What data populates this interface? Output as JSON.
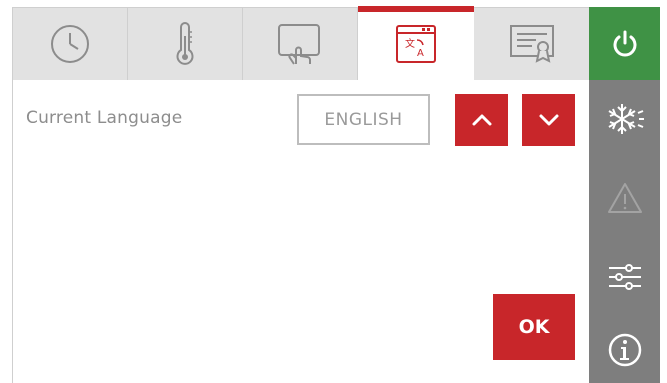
{
  "tabs": [
    {
      "id": "clock",
      "icon": "clock-icon",
      "active": false
    },
    {
      "id": "temperature",
      "icon": "thermometer-icon",
      "active": false
    },
    {
      "id": "touch",
      "icon": "touch-screen-icon",
      "active": false
    },
    {
      "id": "language",
      "icon": "language-translate-icon",
      "active": true
    },
    {
      "id": "certificate",
      "icon": "certificate-icon",
      "active": false
    }
  ],
  "sidebar": {
    "items": [
      {
        "icon": "power-icon",
        "color": "#3f9245"
      },
      {
        "icon": "defrost-icon"
      },
      {
        "icon": "warning-icon"
      },
      {
        "icon": "settings-sliders-icon"
      },
      {
        "icon": "info-icon"
      }
    ]
  },
  "language": {
    "label": "Current Language",
    "value": "ENGLISH"
  },
  "ok_label": "OK",
  "colors": {
    "accent_red": "#c8262a",
    "power_green": "#3f9245",
    "sidebar_gray": "#7e7e7e",
    "tab_gray": "#e2e2e2"
  }
}
